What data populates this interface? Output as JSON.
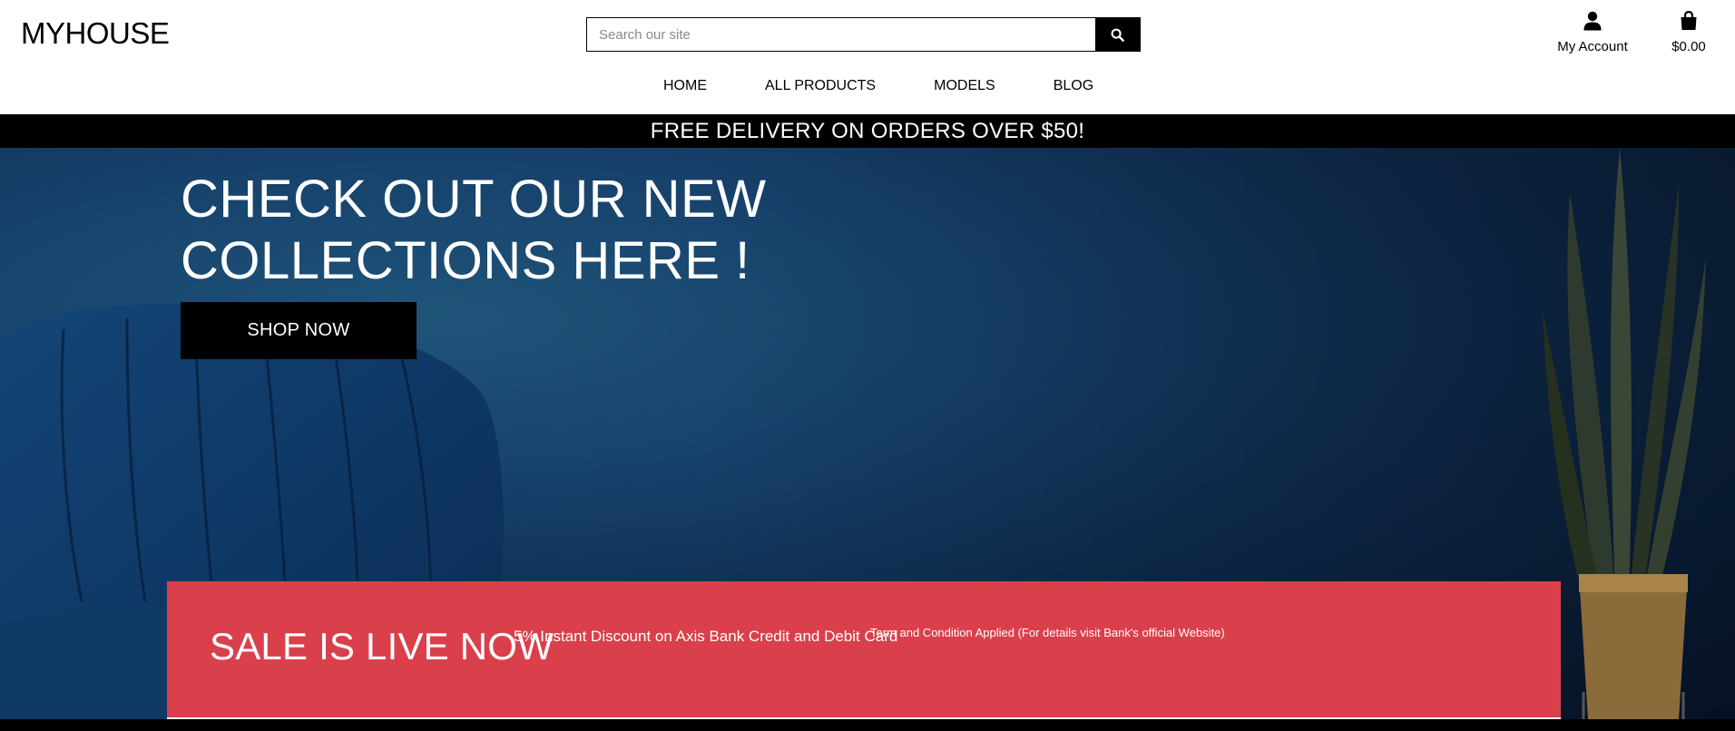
{
  "header": {
    "logo": "MYHOUSE",
    "search": {
      "placeholder": "Search our site",
      "value": ""
    },
    "nav": [
      {
        "label": "HOME"
      },
      {
        "label": "ALL PRODUCTS"
      },
      {
        "label": "MODELS"
      },
      {
        "label": "BLOG"
      }
    ],
    "account_label": "My Account",
    "cart_total": "$0.00"
  },
  "banner": {
    "text": "FREE DELIVERY ON ORDERS OVER $50!"
  },
  "hero": {
    "title_line1": "CHECK OUT OUR NEW",
    "title_line2": "COLLECTIONS HERE !",
    "cta_label": "SHOP NOW"
  },
  "sale": {
    "title": "SALE IS LIVE NOW",
    "discount": "5% Instant Discount on Axis Bank Credit and Debit Card",
    "terms": "Term and Condition Applied (For details visit Bank's official Website)"
  },
  "colors": {
    "sale_bg": "#d9404b",
    "banner_bg": "#000000",
    "hero_bg": "#16406a"
  },
  "icons": {
    "search": "search-icon",
    "account": "user-icon",
    "cart": "shopping-bag-icon"
  }
}
